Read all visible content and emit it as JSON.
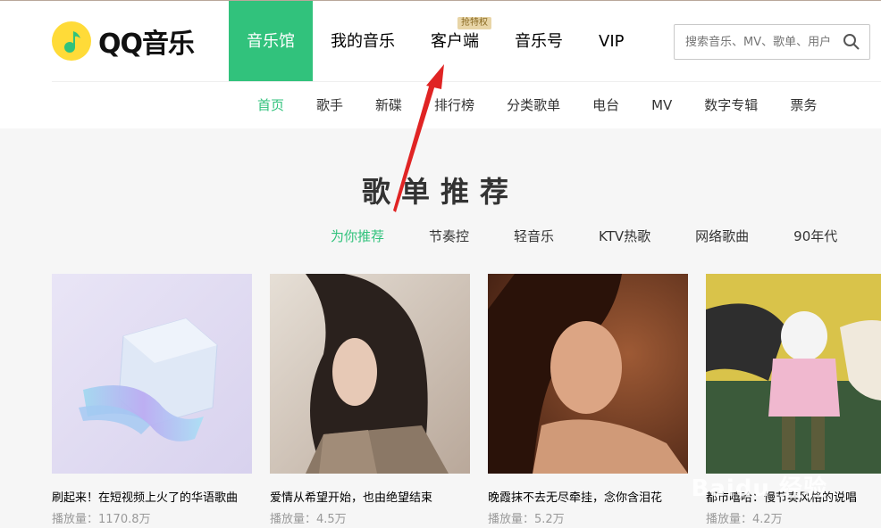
{
  "header": {
    "logo_text": "QQ音乐",
    "nav": [
      {
        "label": "音乐馆",
        "active": true
      },
      {
        "label": "我的音乐"
      },
      {
        "label": "客户端",
        "badge": "抢特权"
      },
      {
        "label": "音乐号"
      },
      {
        "label": "VIP"
      }
    ],
    "search": {
      "placeholder": "搜索音乐、MV、歌单、用户"
    }
  },
  "subnav": [
    "首页",
    "歌手",
    "新碟",
    "排行榜",
    "分类歌单",
    "电台",
    "MV",
    "数字专辑",
    "票务"
  ],
  "section": {
    "title": "歌单推荐",
    "tags": [
      "为你推荐",
      "节奏控",
      "轻音乐",
      "KTV热歌",
      "网络歌曲",
      "90年代"
    ]
  },
  "playlists": [
    {
      "title": "刷起来！在短视频上火了的华语歌曲",
      "plays": "播放量：1170.8万"
    },
    {
      "title": "爱情从希望开始，也由绝望结束",
      "plays": "播放量：4.5万"
    },
    {
      "title": "晚霞抹不去无尽牵挂，念你含泪花",
      "plays": "播放量：5.2万"
    },
    {
      "title": "都市嘻哈：慢节奏风格的说唱",
      "plays": "播放量：4.2万"
    }
  ],
  "watermark": "Baidu 经验",
  "colors": {
    "accent": "#31c27c",
    "arrow": "#e02424"
  }
}
